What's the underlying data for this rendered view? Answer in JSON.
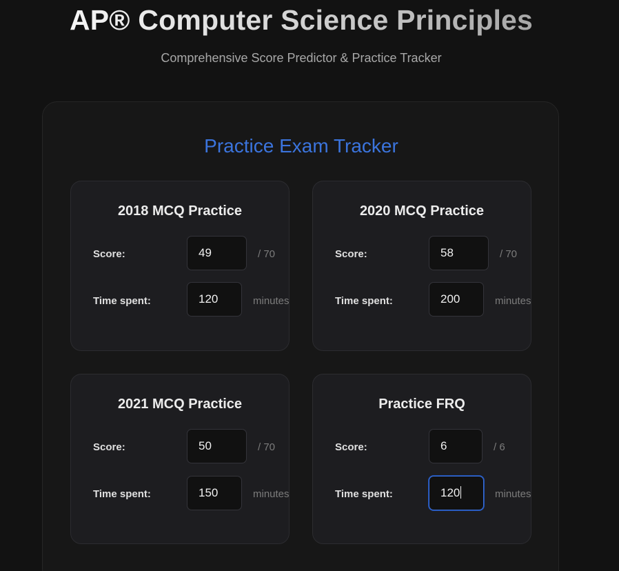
{
  "header": {
    "title": "AP® Computer Science Principles",
    "subtitle": "Comprehensive Score Predictor & Practice Tracker"
  },
  "tracker": {
    "title": "Practice Exam Tracker",
    "accent_color": "#3b74dd",
    "cards": [
      {
        "title": "2018 MCQ Practice",
        "score_label": "Score:",
        "score_value": "49",
        "score_suffix": "/ 70",
        "time_label": "Time spent:",
        "time_value": "120",
        "time_suffix": "minutes"
      },
      {
        "title": "2020 MCQ Practice",
        "score_label": "Score:",
        "score_value": "58",
        "score_suffix": "/ 70",
        "time_label": "Time spent:",
        "time_value": "200",
        "time_suffix": "minutes"
      },
      {
        "title": "2021 MCQ Practice",
        "score_label": "Score:",
        "score_value": "50",
        "score_suffix": "/ 70",
        "time_label": "Time spent:",
        "time_value": "150",
        "time_suffix": "minutes"
      },
      {
        "title": "Practice FRQ",
        "score_label": "Score:",
        "score_value": "6",
        "score_suffix": "/ 6",
        "time_label": "Time spent:",
        "time_value": "120",
        "time_suffix": "minutes"
      }
    ]
  }
}
